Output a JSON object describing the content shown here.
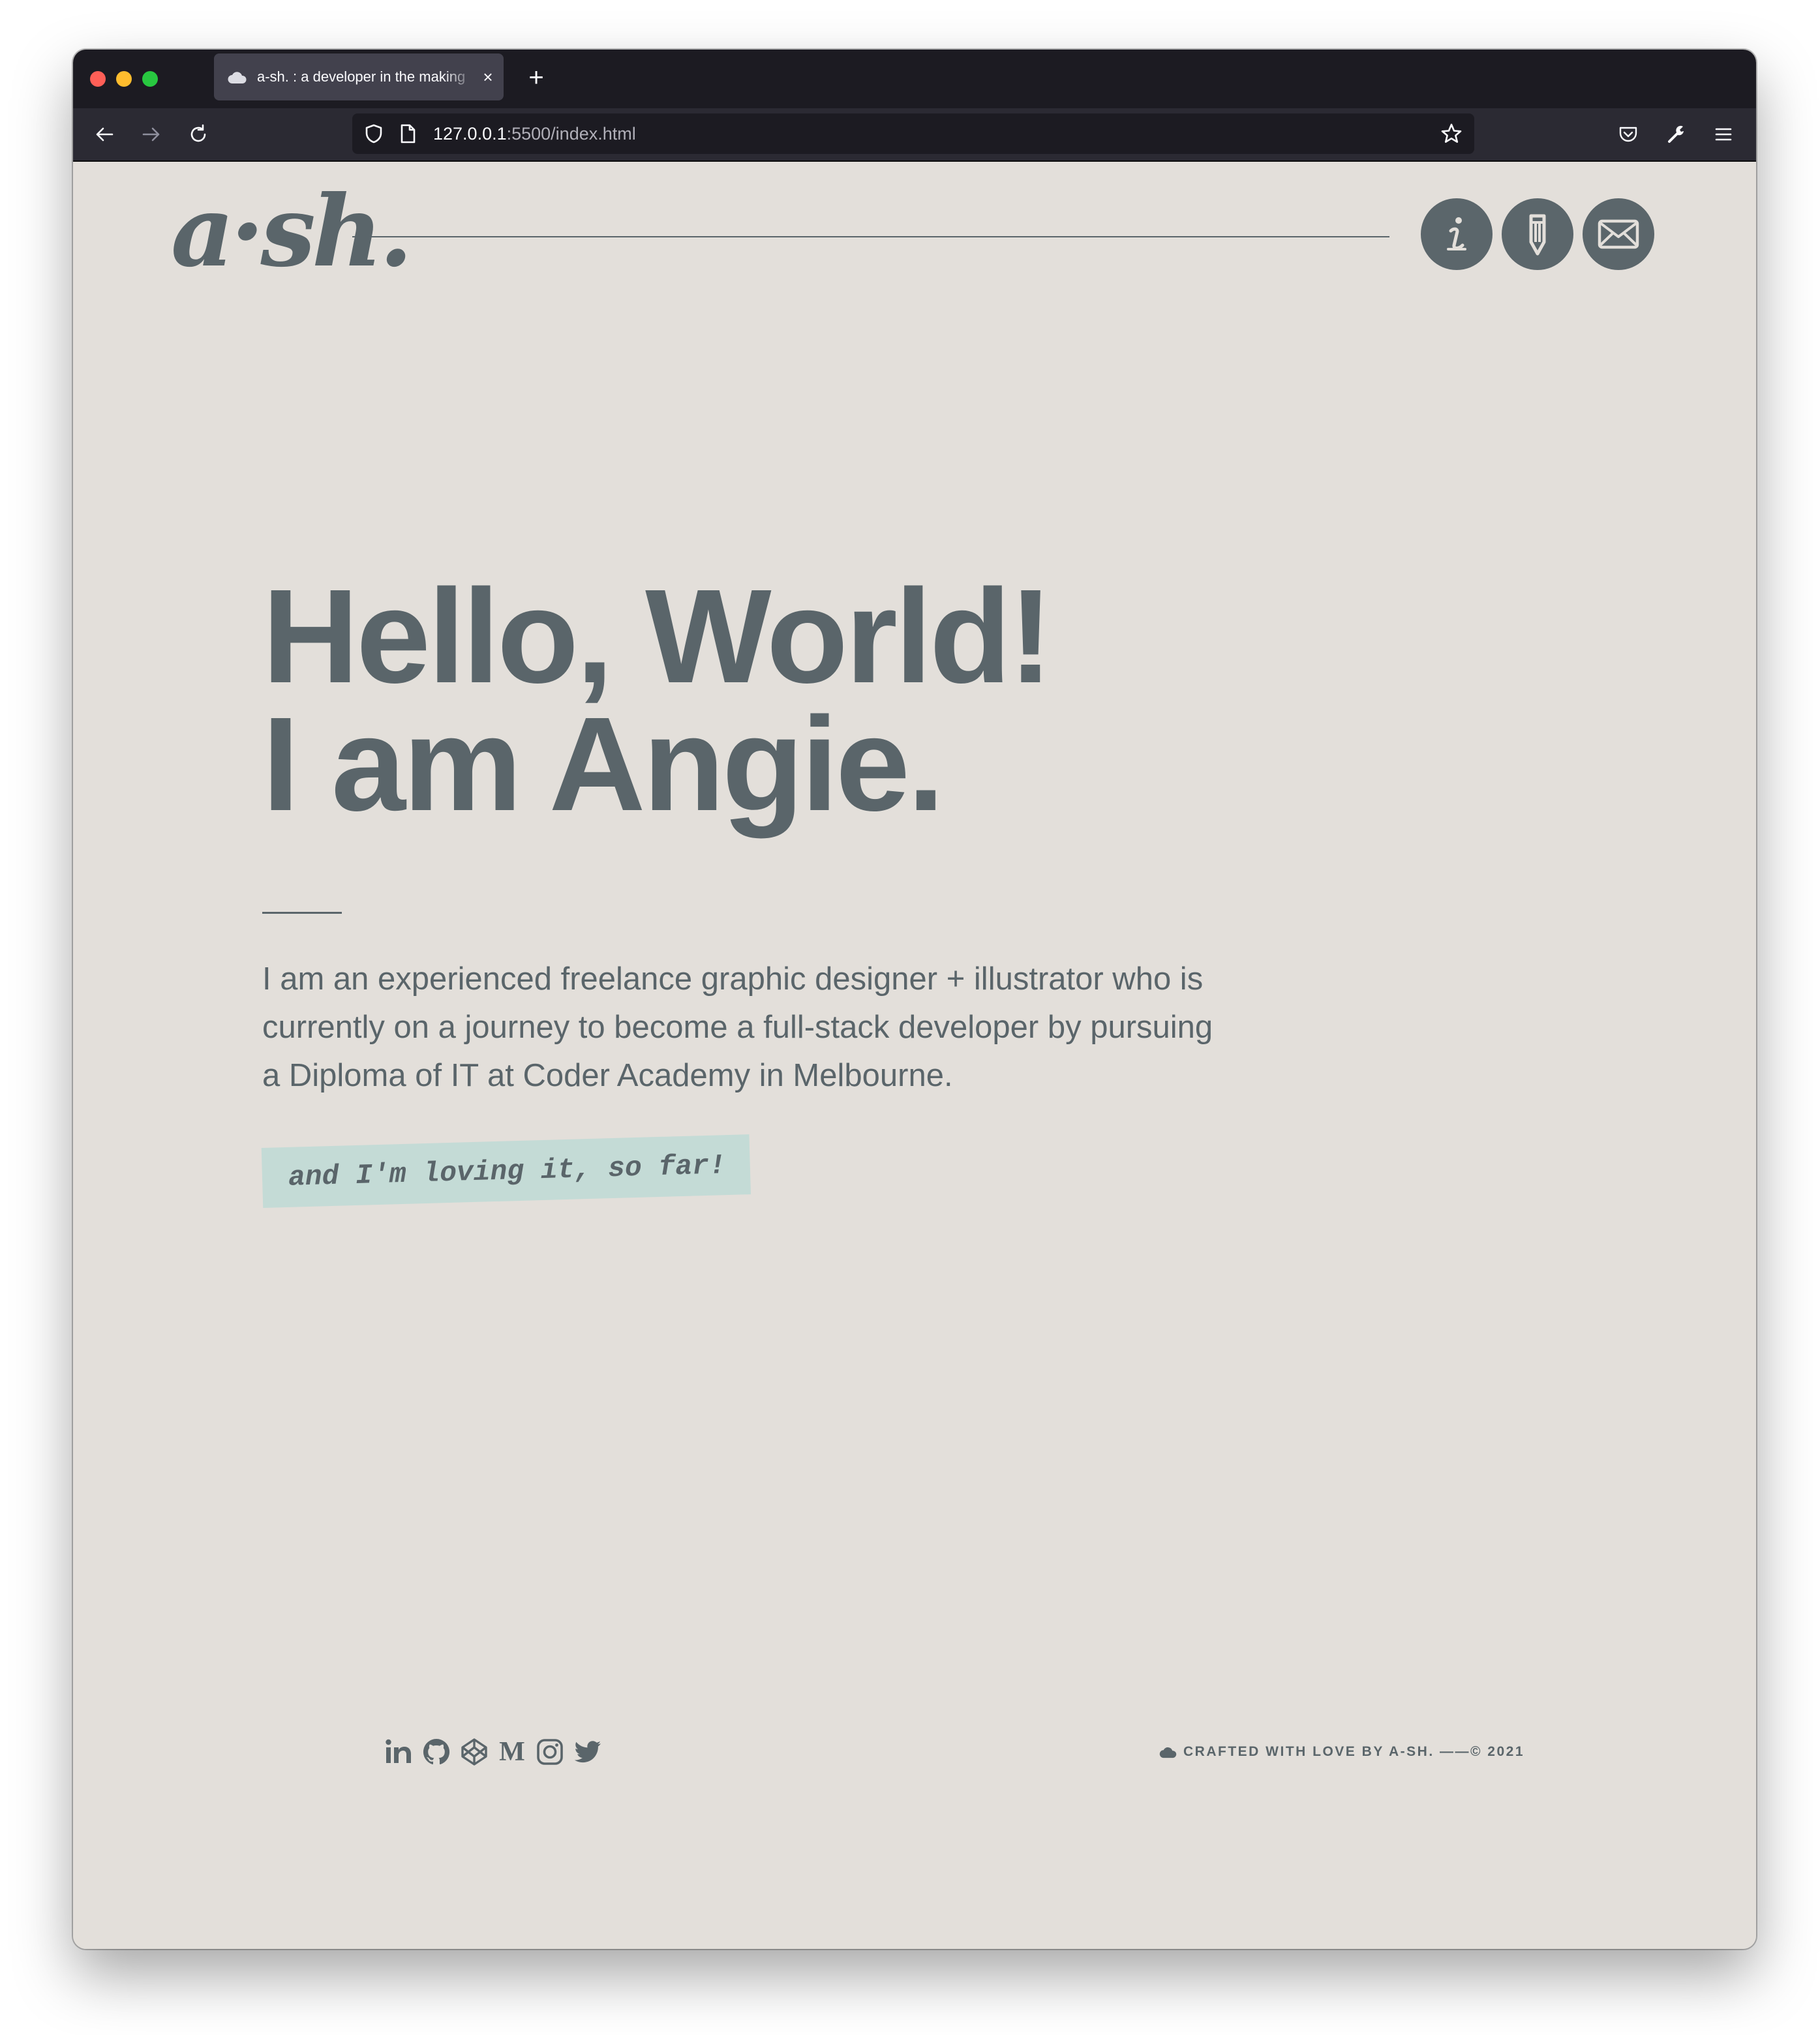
{
  "browser": {
    "tab": {
      "title": "a-sh. : a developer in the making",
      "favicon": "cloud-icon",
      "close_label": "×"
    },
    "new_tab_label": "+",
    "nav": {
      "back": "arrow-left-icon",
      "forward": "arrow-right-icon",
      "reload": "reload-icon"
    },
    "url": {
      "host": "127.0.0.1",
      "rest": ":5500/index.html"
    },
    "toolbar_icons": [
      "shield-icon",
      "page-icon",
      "star-icon",
      "pocket-icon",
      "wrench-icon",
      "menu-icon"
    ]
  },
  "page": {
    "logo": "a·sh.",
    "nav_buttons": [
      {
        "name": "about",
        "icon": "info-icon"
      },
      {
        "name": "projects",
        "icon": "pencil-icon"
      },
      {
        "name": "contact",
        "icon": "envelope-icon"
      }
    ],
    "hero": {
      "line1": "Hello, World!",
      "line2": "I am Angie."
    },
    "bio": "I am an experienced freelance graphic designer + illustrator who is currently on a journey to become a full-stack developer by pursuing a Diploma of IT at Coder Academy in Melbourne.",
    "tagline": "and I'm loving it, so far!",
    "socials": [
      {
        "name": "linkedin",
        "icon": "linkedin-icon"
      },
      {
        "name": "github",
        "icon": "github-icon"
      },
      {
        "name": "codepen",
        "icon": "codepen-icon"
      },
      {
        "name": "medium",
        "icon": "medium-icon"
      },
      {
        "name": "instagram",
        "icon": "instagram-icon"
      },
      {
        "name": "twitter",
        "icon": "twitter-icon"
      }
    ],
    "footer": {
      "credit": "CRAFTED WITH LOVE BY A-SH. ——© 2021",
      "icon": "cloud-icon"
    },
    "colors": {
      "background": "#e3dfda",
      "ink": "#5a656a",
      "accent": "#c4dbd6",
      "chrome_dark": "#1c1b22"
    }
  }
}
